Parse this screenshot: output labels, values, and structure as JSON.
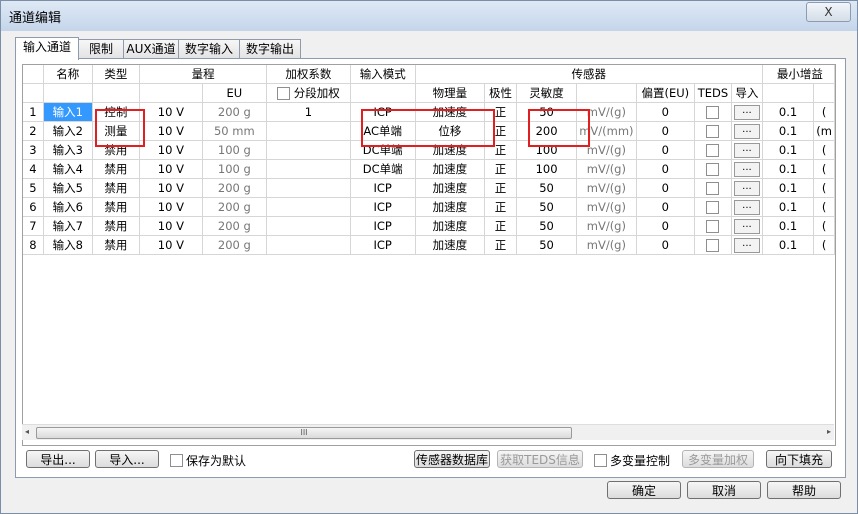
{
  "window": {
    "title": "通道编辑",
    "close_label": "X"
  },
  "tabs": [
    {
      "label": "输入通道"
    },
    {
      "label": "限制"
    },
    {
      "label": "AUX通道"
    },
    {
      "label": "数字输入"
    },
    {
      "label": "数字输出"
    }
  ],
  "header": {
    "name": "名称",
    "type": "类型",
    "range": "量程",
    "weight": "加权系数",
    "input_mode": "输入模式",
    "sensor": "传感器",
    "min_inc": "最小增益",
    "eu": "EU",
    "segmented_weight": "分段加权",
    "physical": "物理量",
    "polarity": "极性",
    "sensitivity": "灵敏度",
    "offset": "偏置(EU)",
    "teds": "TEDS",
    "import": "导入"
  },
  "rows": [
    {
      "idx": "1",
      "name": "输入1",
      "type": "控制",
      "range": "10 V",
      "eu": "200 g",
      "weight": "1",
      "mode": "ICP",
      "phys": "加速度",
      "pol": "正",
      "sens": "50",
      "unit": "mV/(g)",
      "offset": "0",
      "btn": "...",
      "min": "0.1",
      "extra": "("
    },
    {
      "idx": "2",
      "name": "输入2",
      "type": "测量",
      "range": "10 V",
      "eu": "50 mm",
      "weight": "",
      "mode": "AC单端",
      "phys": "位移",
      "pol": "正",
      "sens": "200",
      "unit": "mV/(mm)",
      "offset": "0",
      "btn": "...",
      "min": "0.1",
      "extra": "(m"
    },
    {
      "idx": "3",
      "name": "输入3",
      "type": "禁用",
      "range": "10 V",
      "eu": "100 g",
      "weight": "",
      "mode": "DC单端",
      "phys": "加速度",
      "pol": "正",
      "sens": "100",
      "unit": "mV/(g)",
      "offset": "0",
      "btn": "...",
      "min": "0.1",
      "extra": "("
    },
    {
      "idx": "4",
      "name": "输入4",
      "type": "禁用",
      "range": "10 V",
      "eu": "100 g",
      "weight": "",
      "mode": "DC单端",
      "phys": "加速度",
      "pol": "正",
      "sens": "100",
      "unit": "mV/(g)",
      "offset": "0",
      "btn": "...",
      "min": "0.1",
      "extra": "("
    },
    {
      "idx": "5",
      "name": "输入5",
      "type": "禁用",
      "range": "10 V",
      "eu": "200 g",
      "weight": "",
      "mode": "ICP",
      "phys": "加速度",
      "pol": "正",
      "sens": "50",
      "unit": "mV/(g)",
      "offset": "0",
      "btn": "...",
      "min": "0.1",
      "extra": "("
    },
    {
      "idx": "6",
      "name": "输入6",
      "type": "禁用",
      "range": "10 V",
      "eu": "200 g",
      "weight": "",
      "mode": "ICP",
      "phys": "加速度",
      "pol": "正",
      "sens": "50",
      "unit": "mV/(g)",
      "offset": "0",
      "btn": "...",
      "min": "0.1",
      "extra": "("
    },
    {
      "idx": "7",
      "name": "输入7",
      "type": "禁用",
      "range": "10 V",
      "eu": "200 g",
      "weight": "",
      "mode": "ICP",
      "phys": "加速度",
      "pol": "正",
      "sens": "50",
      "unit": "mV/(g)",
      "offset": "0",
      "btn": "...",
      "min": "0.1",
      "extra": "("
    },
    {
      "idx": "8",
      "name": "输入8",
      "type": "禁用",
      "range": "10 V",
      "eu": "200 g",
      "weight": "",
      "mode": "ICP",
      "phys": "加速度",
      "pol": "正",
      "sens": "50",
      "unit": "mV/(g)",
      "offset": "0",
      "btn": "...",
      "min": "0.1",
      "extra": "("
    }
  ],
  "scroll": {
    "thumb_label": "III",
    "left_arrow": "◂",
    "right_arrow": "▸"
  },
  "bottom": {
    "export": "导出...",
    "import": "导入...",
    "save_default": "保存为默认",
    "sensor_db": "传感器数据库",
    "get_teds": "获取TEDS信息",
    "multivar_control": "多变量控制",
    "multivar_weight": "多变量加权",
    "fill_down": "向下填充"
  },
  "dialog": {
    "ok": "确定",
    "cancel": "取消",
    "help": "帮助"
  },
  "colors": {
    "highlight": "#e02020",
    "selection": "#3399ff"
  }
}
